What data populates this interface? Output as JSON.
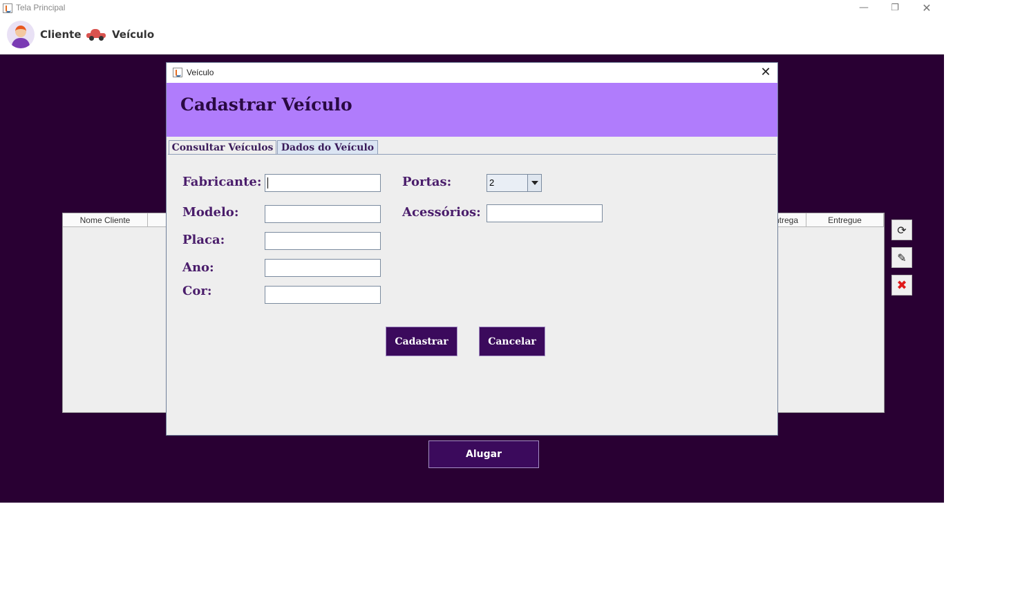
{
  "window": {
    "title": "Tela Principal",
    "controls": {
      "minimize": "—",
      "maximize": "❐",
      "close": "✕"
    }
  },
  "menu": {
    "items": [
      {
        "label": "Cliente",
        "icon": "user-avatar-icon"
      },
      {
        "label": "Veículo",
        "icon": "car-icon"
      }
    ]
  },
  "main": {
    "table": {
      "columns": [
        "Nome Cliente",
        "ntrega",
        "Entregue"
      ],
      "rows": []
    },
    "side_buttons": [
      {
        "icon": "refresh-icon",
        "glyph": "⟳"
      },
      {
        "icon": "edit-icon",
        "glyph": "✎"
      },
      {
        "icon": "delete-icon",
        "glyph": "✖"
      }
    ],
    "alugar_label": "Alugar"
  },
  "dialog": {
    "title": "Veículo",
    "close_glyph": "✕",
    "heading": "Cadastrar Veículo",
    "tabs": [
      {
        "label": "Consultar Veículos",
        "active": false
      },
      {
        "label": "Dados do Veículo",
        "active": true
      }
    ],
    "form": {
      "fabricante_label": "Fabricante:",
      "fabricante_value": "",
      "modelo_label": "Modelo:",
      "modelo_value": "",
      "placa_label": "Placa:",
      "placa_value": "",
      "ano_label": "Ano:",
      "ano_value": "",
      "cor_label": "Cor:",
      "cor_value": "",
      "portas_label": "Portas:",
      "portas_value": "2",
      "acessorios_label": "Acessórios:",
      "acessorios_value": ""
    },
    "buttons": {
      "cadastrar": "Cadastrar",
      "cancelar": "Cancelar"
    }
  },
  "colors": {
    "main_background": "#290033",
    "dialog_header": "#b07cfc",
    "button_background": "#3b0a5c",
    "label_text": "#4a1d6b"
  }
}
